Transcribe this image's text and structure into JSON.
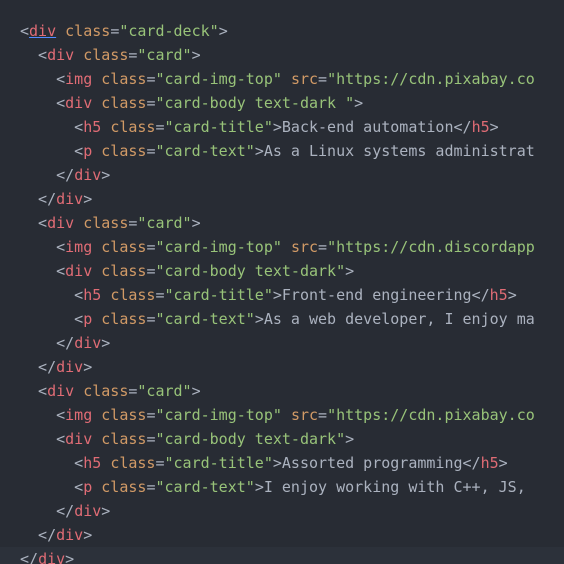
{
  "lines": [
    {
      "tokens": [
        [
          "p",
          "<"
        ],
        [
          "t",
          "div",
          "m"
        ],
        [
          "p",
          " "
        ],
        [
          "a",
          "class"
        ],
        [
          "p",
          "="
        ],
        [
          "s",
          "\"card-deck\""
        ],
        [
          "p",
          ">"
        ]
      ]
    },
    {
      "tokens": [
        [
          "p",
          "  <"
        ],
        [
          "t",
          "div"
        ],
        [
          "p",
          " "
        ],
        [
          "a",
          "class"
        ],
        [
          "p",
          "="
        ],
        [
          "s",
          "\"card\""
        ],
        [
          "p",
          ">"
        ]
      ]
    },
    {
      "tokens": [
        [
          "p",
          "    <"
        ],
        [
          "t",
          "img"
        ],
        [
          "p",
          " "
        ],
        [
          "a",
          "class"
        ],
        [
          "p",
          "="
        ],
        [
          "s",
          "\"card-img-top\""
        ],
        [
          "p",
          " "
        ],
        [
          "a",
          "src"
        ],
        [
          "p",
          "="
        ],
        [
          "s",
          "\"https://cdn.pixabay.co"
        ]
      ]
    },
    {
      "tokens": [
        [
          "p",
          "    <"
        ],
        [
          "t",
          "div"
        ],
        [
          "p",
          " "
        ],
        [
          "a",
          "class"
        ],
        [
          "p",
          "="
        ],
        [
          "s",
          "\"card-body text-dark \""
        ],
        [
          "p",
          ">"
        ]
      ]
    },
    {
      "tokens": [
        [
          "p",
          "      <"
        ],
        [
          "t",
          "h5"
        ],
        [
          "p",
          " "
        ],
        [
          "a",
          "class"
        ],
        [
          "p",
          "="
        ],
        [
          "s",
          "\"card-title\""
        ],
        [
          "p",
          ">"
        ],
        [
          "x",
          "Back-end automation"
        ],
        [
          "p",
          "</"
        ],
        [
          "t",
          "h5"
        ],
        [
          "p",
          ">"
        ]
      ]
    },
    {
      "tokens": [
        [
          "p",
          "      <"
        ],
        [
          "t",
          "p"
        ],
        [
          "p",
          " "
        ],
        [
          "a",
          "class"
        ],
        [
          "p",
          "="
        ],
        [
          "s",
          "\"card-text\""
        ],
        [
          "p",
          ">"
        ],
        [
          "x",
          "As a Linux systems administrat"
        ]
      ]
    },
    {
      "tokens": [
        [
          "p",
          "    </"
        ],
        [
          "t",
          "div"
        ],
        [
          "p",
          ">"
        ]
      ]
    },
    {
      "tokens": [
        [
          "p",
          "  </"
        ],
        [
          "t",
          "div"
        ],
        [
          "p",
          ">"
        ]
      ]
    },
    {
      "tokens": [
        [
          "p",
          "  <"
        ],
        [
          "t",
          "div"
        ],
        [
          "p",
          " "
        ],
        [
          "a",
          "class"
        ],
        [
          "p",
          "="
        ],
        [
          "s",
          "\"card\""
        ],
        [
          "p",
          ">"
        ]
      ]
    },
    {
      "tokens": [
        [
          "p",
          "    <"
        ],
        [
          "t",
          "img"
        ],
        [
          "p",
          " "
        ],
        [
          "a",
          "class"
        ],
        [
          "p",
          "="
        ],
        [
          "s",
          "\"card-img-top\""
        ],
        [
          "p",
          " "
        ],
        [
          "a",
          "src"
        ],
        [
          "p",
          "="
        ],
        [
          "s",
          "\"https://cdn.discordapp"
        ]
      ]
    },
    {
      "tokens": [
        [
          "p",
          "    <"
        ],
        [
          "t",
          "div"
        ],
        [
          "p",
          " "
        ],
        [
          "a",
          "class"
        ],
        [
          "p",
          "="
        ],
        [
          "s",
          "\"card-body text-dark\""
        ],
        [
          "p",
          ">"
        ]
      ]
    },
    {
      "tokens": [
        [
          "p",
          "      <"
        ],
        [
          "t",
          "h5"
        ],
        [
          "p",
          " "
        ],
        [
          "a",
          "class"
        ],
        [
          "p",
          "="
        ],
        [
          "s",
          "\"card-title\""
        ],
        [
          "p",
          ">"
        ],
        [
          "x",
          "Front-end engineering"
        ],
        [
          "p",
          "</"
        ],
        [
          "t",
          "h5"
        ],
        [
          "p",
          ">"
        ]
      ]
    },
    {
      "tokens": [
        [
          "p",
          "      <"
        ],
        [
          "t",
          "p"
        ],
        [
          "p",
          " "
        ],
        [
          "a",
          "class"
        ],
        [
          "p",
          "="
        ],
        [
          "s",
          "\"card-text\""
        ],
        [
          "p",
          ">"
        ],
        [
          "x",
          "As a web developer, I enjoy ma"
        ]
      ]
    },
    {
      "tokens": [
        [
          "p",
          "    </"
        ],
        [
          "t",
          "div"
        ],
        [
          "p",
          ">"
        ]
      ]
    },
    {
      "tokens": [
        [
          "p",
          "  </"
        ],
        [
          "t",
          "div"
        ],
        [
          "p",
          ">"
        ]
      ]
    },
    {
      "tokens": [
        [
          "p",
          "  <"
        ],
        [
          "t",
          "div"
        ],
        [
          "p",
          " "
        ],
        [
          "a",
          "class"
        ],
        [
          "p",
          "="
        ],
        [
          "s",
          "\"card\""
        ],
        [
          "p",
          ">"
        ]
      ]
    },
    {
      "tokens": [
        [
          "p",
          "    <"
        ],
        [
          "t",
          "img"
        ],
        [
          "p",
          " "
        ],
        [
          "a",
          "class"
        ],
        [
          "p",
          "="
        ],
        [
          "s",
          "\"card-img-top\""
        ],
        [
          "p",
          " "
        ],
        [
          "a",
          "src"
        ],
        [
          "p",
          "="
        ],
        [
          "s",
          "\"https://cdn.pixabay.co"
        ]
      ]
    },
    {
      "tokens": [
        [
          "p",
          "    <"
        ],
        [
          "t",
          "div"
        ],
        [
          "p",
          " "
        ],
        [
          "a",
          "class"
        ],
        [
          "p",
          "="
        ],
        [
          "s",
          "\"card-body text-dark\""
        ],
        [
          "p",
          ">"
        ]
      ]
    },
    {
      "tokens": [
        [
          "p",
          "      <"
        ],
        [
          "t",
          "h5"
        ],
        [
          "p",
          " "
        ],
        [
          "a",
          "class"
        ],
        [
          "p",
          "="
        ],
        [
          "s",
          "\"card-title\""
        ],
        [
          "p",
          ">"
        ],
        [
          "x",
          "Assorted programming"
        ],
        [
          "p",
          "</"
        ],
        [
          "t",
          "h5"
        ],
        [
          "p",
          ">"
        ]
      ]
    },
    {
      "tokens": [
        [
          "p",
          "      <"
        ],
        [
          "t",
          "p"
        ],
        [
          "p",
          " "
        ],
        [
          "a",
          "class"
        ],
        [
          "p",
          "="
        ],
        [
          "s",
          "\"card-text\""
        ],
        [
          "p",
          ">"
        ],
        [
          "x",
          "I enjoy working with C++, JS,"
        ]
      ]
    },
    {
      "tokens": [
        [
          "p",
          "    </"
        ],
        [
          "t",
          "div"
        ],
        [
          "p",
          ">"
        ]
      ]
    },
    {
      "tokens": [
        [
          "p",
          "  </"
        ],
        [
          "t",
          "div"
        ],
        [
          "p",
          ">"
        ]
      ]
    },
    {
      "current": true,
      "tokens": [
        [
          "p",
          "</"
        ],
        [
          "t",
          "div"
        ],
        [
          "p",
          ">"
        ]
      ]
    }
  ],
  "colors": {
    "background": "#282c34",
    "current_line": "#2c313a",
    "punctuation": "#abb2bf",
    "tag": "#e06c75",
    "attribute": "#d19a66",
    "string": "#98c379",
    "text": "#abb2bf",
    "bracket_match": "#528bff"
  }
}
